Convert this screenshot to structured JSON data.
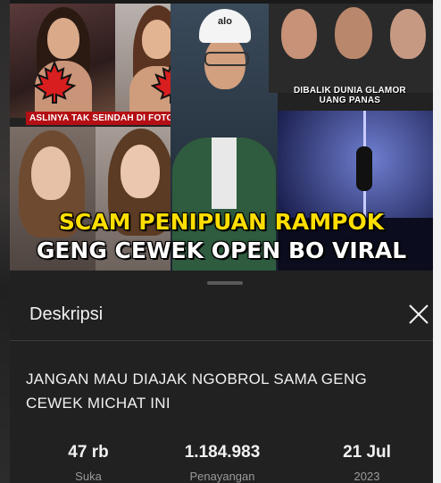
{
  "thumbnail": {
    "tag_left": "ASLINYA TAK SEINDAH DI FOTO",
    "tag_right_line1": "DIBALIK DUNIA GLAMOR",
    "tag_right_line2": "UANG PANAS",
    "cap_logo": "alo",
    "headline_line1": "SCAM PENIPUAN RAMPOK",
    "headline_line2": "GENG CEWEK OPEN BO VIRAL"
  },
  "sheet": {
    "title": "Deskripsi",
    "close_icon": "close-icon",
    "description": "JANGAN MAU DIAJAK NGOBROL SAMA GENG CEWEK MICHAT INI",
    "stats": [
      {
        "value": "47 rb",
        "label": "Suka"
      },
      {
        "value": "1.184.983",
        "label": "Penayangan"
      },
      {
        "value": "21 Jul",
        "label": "2023"
      }
    ]
  },
  "colors": {
    "accent_yellow": "#ffde00",
    "tag_red": "#b40f14",
    "sheet_bg": "#212121"
  }
}
